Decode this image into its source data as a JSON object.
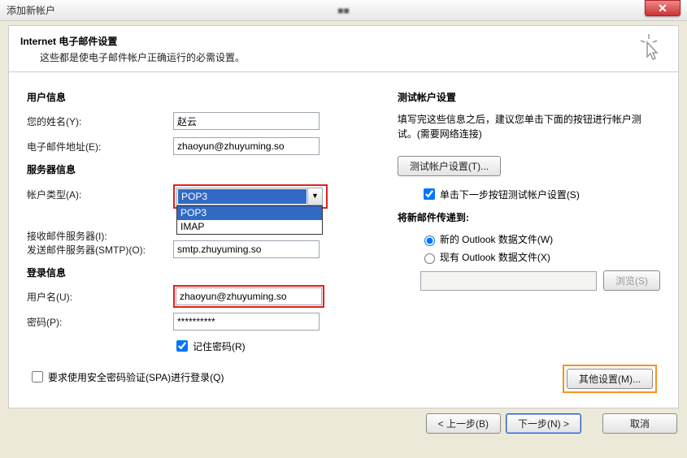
{
  "window": {
    "title": "添加新帐户",
    "center_blur": "■■"
  },
  "header": {
    "title": "Internet 电子邮件设置",
    "subtitle": "这些都是使电子邮件帐户正确运行的必需设置。"
  },
  "sections": {
    "user_info": "用户信息",
    "server_info": "服务器信息",
    "login_info": "登录信息"
  },
  "labels": {
    "your_name": "您的姓名(Y):",
    "email": "电子邮件地址(E):",
    "account_type": "帐户类型(A):",
    "incoming": "接收邮件服务器(I):",
    "outgoing": "发送邮件服务器(SMTP)(O):",
    "username": "用户名(U):",
    "password": "密码(P):",
    "remember_pw": "记住密码(R)",
    "spa": "要求使用安全密码验证(SPA)进行登录(Q)"
  },
  "values": {
    "your_name": "赵云",
    "email": "zhaoyun@zhuyuming.so",
    "account_type_selected": "POP3",
    "account_type_options": [
      "POP3",
      "IMAP"
    ],
    "incoming": "",
    "outgoing": "smtp.zhuyuming.so",
    "username": "zhaoyun@zhuyuming.so",
    "password": "**********"
  },
  "right": {
    "test_title": "测试帐户设置",
    "test_desc": "填写完这些信息之后，建议您单击下面的按钮进行帐户测试。(需要网络连接)",
    "test_btn": "测试帐户设置(T)...",
    "test_cb": "单击下一步按钮测试帐户设置(S)",
    "deliver_title": "将新邮件传递到:",
    "radio_new": "新的 Outlook 数据文件(W)",
    "radio_existing": "现有 Outlook 数据文件(X)",
    "browse": "浏览(S)",
    "other_settings": "其他设置(M)..."
  },
  "footer": {
    "back": "< 上一步(B)",
    "next": "下一步(N) >",
    "cancel": "取消"
  }
}
